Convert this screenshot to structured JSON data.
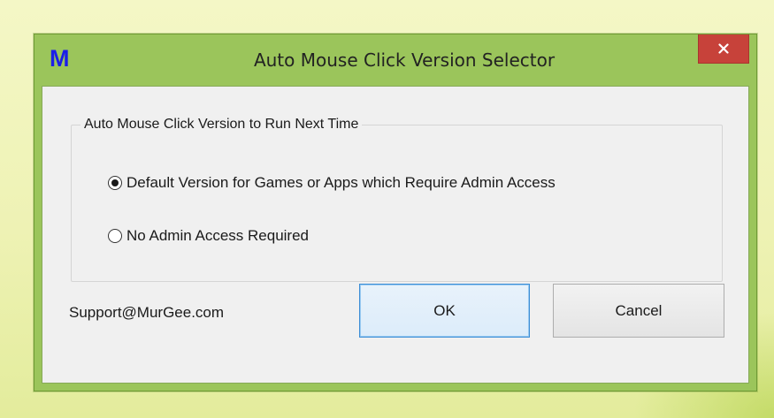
{
  "window": {
    "app_icon_letter": "M",
    "title": "Auto Mouse Click Version Selector",
    "close_symbol": "×"
  },
  "group": {
    "legend": "Auto Mouse Click Version to Run Next Time",
    "options": [
      {
        "label": "Default Version for Games or Apps which Require Admin Access",
        "selected": true
      },
      {
        "label": "No Admin Access Required",
        "selected": false
      }
    ]
  },
  "footer": {
    "support_email": "Support@MurGee.com",
    "ok_label": "OK",
    "cancel_label": "Cancel"
  },
  "colors": {
    "window_frame": "#9bc55b",
    "close_button": "#c7423a",
    "app_icon": "#1b1ee8",
    "ok_border": "#3c8ed6",
    "dialog_background": "#f0f0f0"
  },
  "icons": {
    "app": "murgee-m-icon",
    "close": "close-icon"
  }
}
